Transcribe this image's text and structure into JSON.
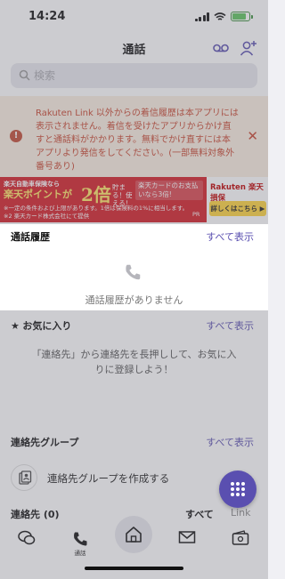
{
  "status_bar": {
    "time": "14:24"
  },
  "header": {
    "title": "通話"
  },
  "search": {
    "placeholder": "検索"
  },
  "notice": {
    "text": "Rakuten Link 以外からの着信履歴は本アプリには表示されません。着信を受けたアプリからかけ直すと通話料がかかります。無料でかけ直すには本アプリより発信をしてください。(一部無料対象外番号あり)"
  },
  "ad": {
    "line1": "楽天自動車保険なら",
    "points": "楽天ポイントが",
    "ga": "が",
    "double": "2倍",
    "mid": "貯まる！使える！",
    "card": "楽天カードのお支払いなら3倍!",
    "foot1": "※一定の条件および上限があります。1倍は保険料の1%に相当します。",
    "foot2": "※2 楽天カード株式会社にて提供",
    "pr": "PR",
    "brand": "Rakuten 楽天損保",
    "cta": "詳しくはこちら ▶"
  },
  "history": {
    "title": "通話履歴",
    "see_all": "すべて表示",
    "empty": "通話履歴がありません"
  },
  "favorites": {
    "title": "お気に入り",
    "see_all": "すべて表示",
    "message": "「連絡先」から連絡先を長押しして、お気に入りに登録しよう！"
  },
  "groups": {
    "title": "連絡先グループ",
    "see_all": "すべて表示",
    "create": "連絡先グループを作成する"
  },
  "contacts": {
    "title": "連絡先 (0)",
    "filter_all": "すべて",
    "filter_link": "Link"
  },
  "tabbar": {
    "call_label": "通話"
  },
  "colors": {
    "accent": "#5a4fb0",
    "notice_text": "#c8462f",
    "notice_bg": "#fbeee0",
    "ad_red": "#d41e26"
  }
}
